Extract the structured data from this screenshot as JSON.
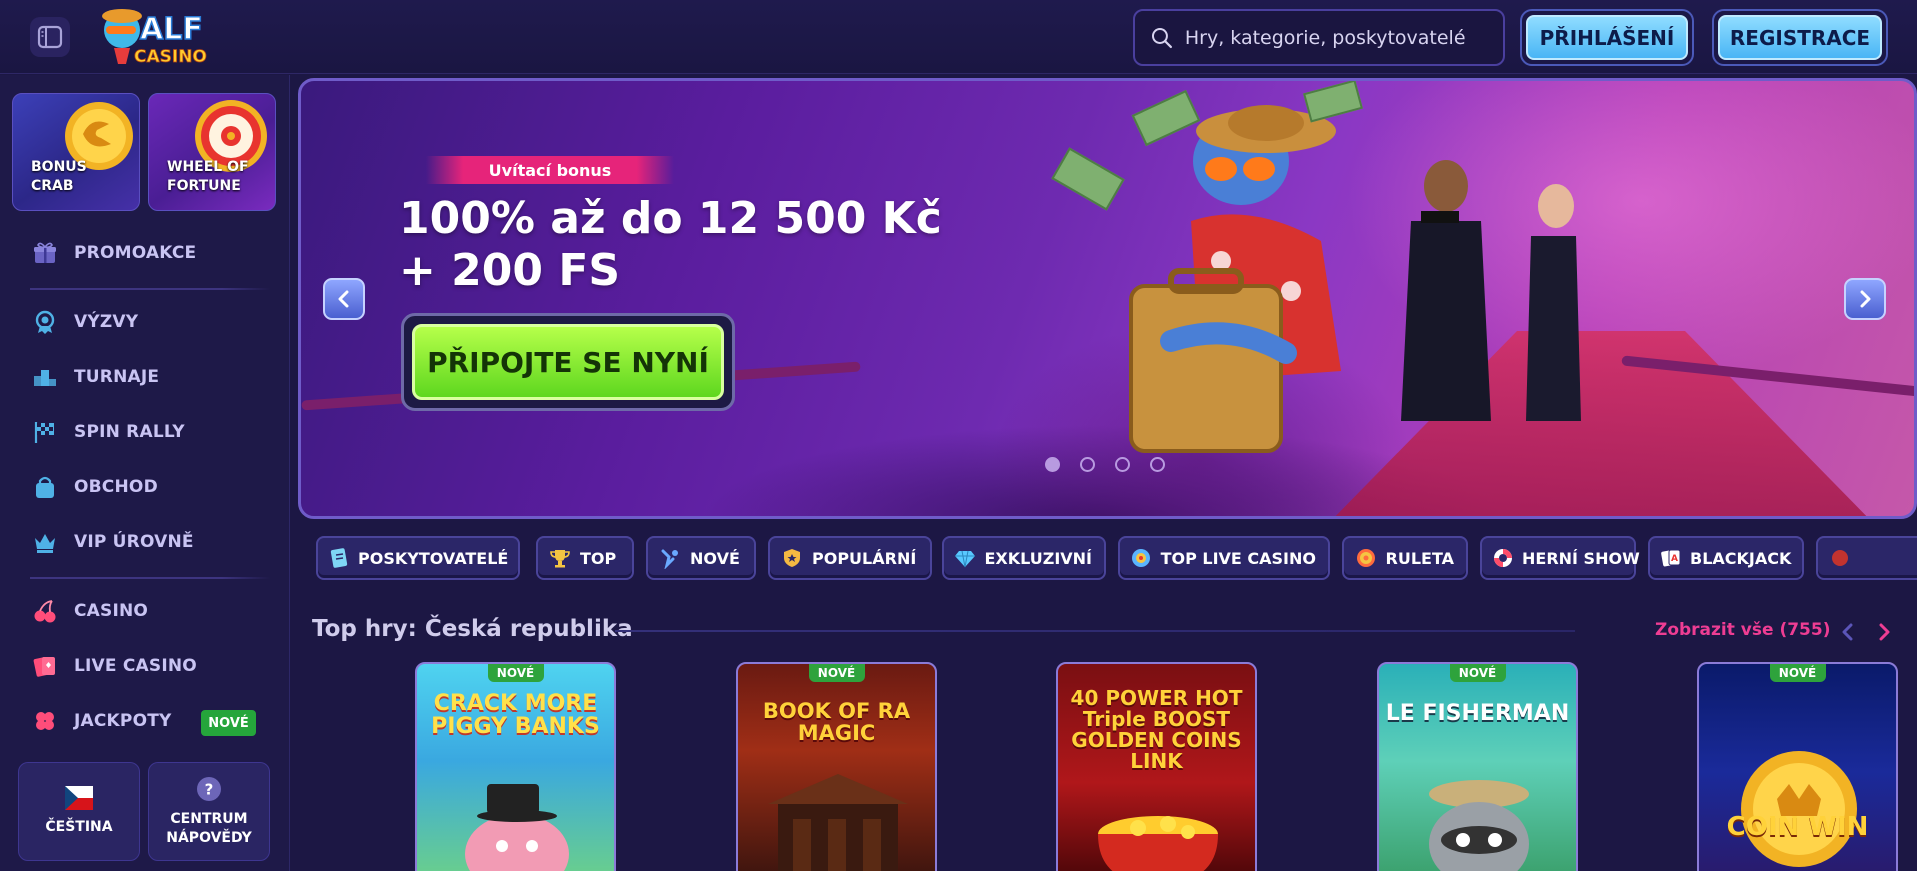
{
  "header": {
    "logo_text": "ALF CASINO",
    "search_placeholder": "Hry, kategorie, poskytovatelé",
    "login_label": "PŘIHLÁŠENÍ",
    "register_label": "REGISTRACE"
  },
  "sidebar": {
    "promo_cards": [
      {
        "label_line1": "BONUS",
        "label_line2": "CRAB"
      },
      {
        "label_line1": "WHEEL OF",
        "label_line2": "FORTUNE"
      }
    ],
    "items": [
      {
        "label": "PROMOAKCE",
        "icon": "gift-icon"
      },
      {
        "label": "VÝZVY",
        "icon": "medal-icon"
      },
      {
        "label": "TURNAJE",
        "icon": "podium-icon"
      },
      {
        "label": "SPIN RALLY",
        "icon": "checkered-flag-icon"
      },
      {
        "label": "OBCHOD",
        "icon": "shopping-bag-icon"
      },
      {
        "label": "VIP ÚROVNĚ",
        "icon": "crown-icon"
      },
      {
        "label": "CASINO",
        "icon": "cherries-icon"
      },
      {
        "label": "LIVE CASINO",
        "icon": "cards-icon"
      },
      {
        "label": "JACKPOTY",
        "icon": "clover-icon"
      }
    ],
    "new_badge": "NOVÉ",
    "language_label": "ČEŠTINA",
    "help_label_line1": "CENTRUM",
    "help_label_line2": "NÁPOVĚDY"
  },
  "hero": {
    "tag": "Uvítací bonus",
    "title_line1": "100% až do 12 500 Kč",
    "title_line2": "+ 200 FS",
    "cta_label": "PŘIPOJTE SE NYNÍ",
    "slide_count": 4,
    "active_slide": 1
  },
  "categories": [
    {
      "label": "POSKYTOVATELÉ",
      "icon": "document-icon",
      "color": "#7ed6f5"
    },
    {
      "label": "TOP",
      "icon": "trophy-icon",
      "color": "#f5c542"
    },
    {
      "label": "NOVÉ",
      "icon": "new-icon",
      "color": "#6aa9ff"
    },
    {
      "label": "POPULÁRNÍ",
      "icon": "shield-icon",
      "color": "#f5b942"
    },
    {
      "label": "EXKLUZIVNÍ",
      "icon": "diamond-icon",
      "color": "#58c8ff"
    },
    {
      "label": "TOP LIVE CASINO",
      "icon": "live-icon",
      "color": "#5ab4ff"
    },
    {
      "label": "RULETA",
      "icon": "roulette-icon",
      "color": "#ff6b3d"
    },
    {
      "label": "HERNÍ SHOW",
      "icon": "lifebuoy-icon",
      "color": "#ff4d6a"
    },
    {
      "label": "BLACKJACK",
      "icon": "blackjack-icon",
      "color": "#ffffff"
    }
  ],
  "top_games": {
    "title": "Top hry: Česká republika",
    "view_all": "Zobrazit vše (755)",
    "games": [
      {
        "title": "CRACK MORE PIGGY BANKS",
        "badge": "NOVÉ"
      },
      {
        "title": "BOOK OF RA MAGIC",
        "badge": "NOVÉ"
      },
      {
        "title": "40 POWER HOT Triple BOOST GOLDEN COINS LINK",
        "badge": ""
      },
      {
        "title": "LE FISHERMAN",
        "badge": "NOVÉ"
      },
      {
        "title": "COIN WIN",
        "badge": "NOVÉ"
      }
    ]
  }
}
